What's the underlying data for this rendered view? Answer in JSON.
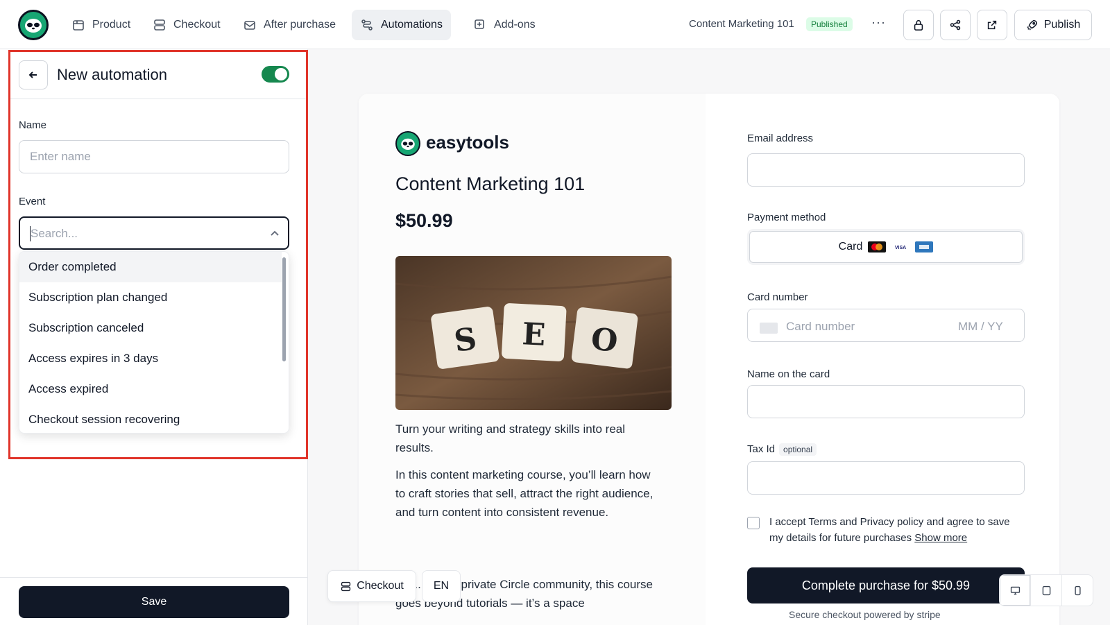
{
  "nav": {
    "items": [
      {
        "label": "Product",
        "icon": "package-icon"
      },
      {
        "label": "Checkout",
        "icon": "checkout-icon"
      },
      {
        "label": "After purchase",
        "icon": "mail-icon"
      },
      {
        "label": "Automations",
        "icon": "automation-icon",
        "active": true
      },
      {
        "label": "Add-ons",
        "icon": "plus-square-icon"
      }
    ],
    "product_title": "Content Marketing 101",
    "status_badge": "Published",
    "more": "···",
    "publish_label": "Publish"
  },
  "panel": {
    "title": "New automation",
    "enabled": true,
    "name_label": "Name",
    "name_placeholder": "Enter name",
    "event_label": "Event",
    "event_placeholder": "Search...",
    "events": [
      "Order completed",
      "Subscription plan changed",
      "Subscription canceled",
      "Access expires in 3 days",
      "Access expired",
      "Checkout session recovering"
    ],
    "save_label": "Save"
  },
  "preview": {
    "brand": "easytools",
    "product_title": "Content Marketing 101",
    "price": "$50.99",
    "image_tiles": [
      "S",
      "E",
      "O"
    ],
    "desc1": "Turn your writing and strategy skills into real results.",
    "desc2": "In this content marketing course, you’ll learn how to craft stories that sell, attract the right audience, and turn content into consistent revenue.",
    "desc3": "...st...de our private Circle community, this course goes beyond tutorials — it’s a space",
    "email_label": "Email address",
    "payment_label": "Payment method",
    "payment_card": "Card",
    "card_number_label": "Card number",
    "card_number_placeholder": "Card number",
    "card_exp_placeholder": "MM / YY",
    "name_on_card_label": "Name on the card",
    "tax_label": "Tax Id",
    "tax_optional": "optional",
    "terms_text": "I accept Terms and Privacy policy and agree to save my details for future purchases",
    "terms_link": "Show more",
    "buy_label": "Complete purchase for $50.99",
    "secure_text": "Secure checkout powered by stripe"
  },
  "floating": {
    "checkout_label": "Checkout",
    "lang_label": "EN"
  },
  "colors": {
    "accent_green": "#16884f",
    "brand_green": "#17a673",
    "highlight_red": "#e0352b",
    "dark_button": "#111827"
  }
}
